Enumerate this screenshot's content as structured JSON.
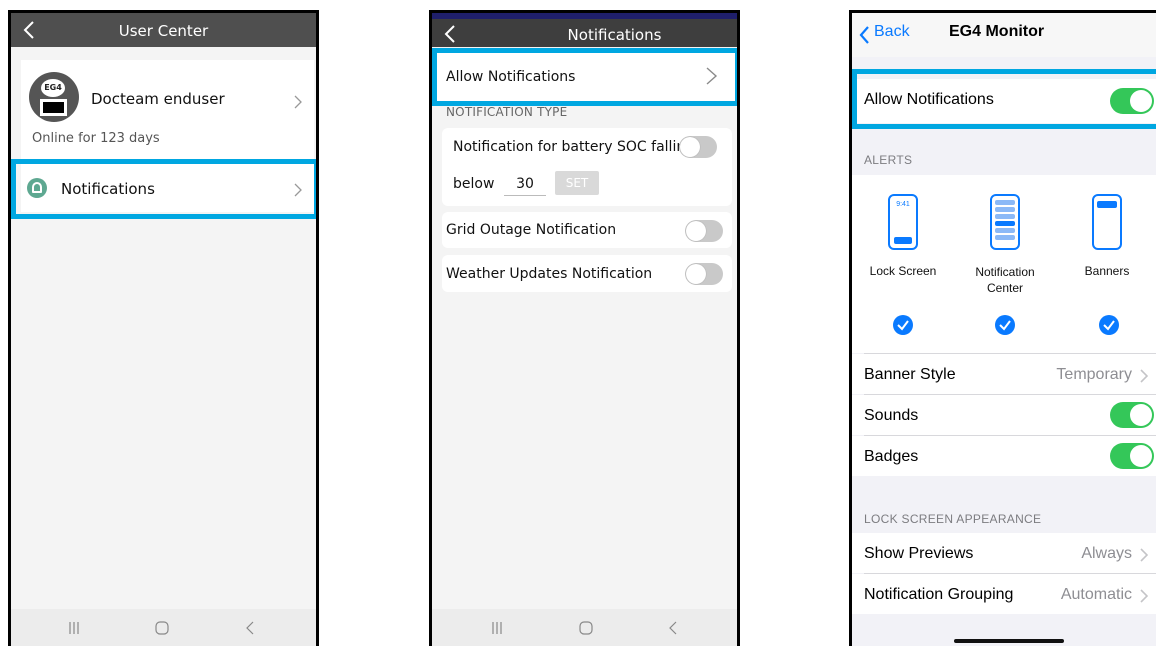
{
  "panel1": {
    "title": "User Center",
    "user_name": "Docteam enduser",
    "online": "Online for 123 days",
    "notifications_label": "Notifications",
    "avatar_text": "EG4"
  },
  "panel2": {
    "title": "Notifications",
    "allow_label": "Allow Notifications",
    "section_label": "NOTIFICATION TYPE",
    "soc_label": "Notification for battery SOC falling",
    "below_label": "below",
    "below_value": "30",
    "set_label": "SET",
    "grid_label": "Grid Outage Notification",
    "weather_label": "Weather Updates Notification"
  },
  "panel3": {
    "back_label": "Back",
    "title": "EG4 Monitor",
    "allow_label": "Allow Notifications",
    "alerts_section": "ALERTS",
    "lock_screen": "Lock Screen",
    "notif_center_1": "Notification",
    "notif_center_2": "Center",
    "banners": "Banners",
    "phone_time": "9:41",
    "banner_style_label": "Banner Style",
    "banner_style_value": "Temporary",
    "sounds_label": "Sounds",
    "badges_label": "Badges",
    "lock_section": "LOCK SCREEN APPEARANCE",
    "previews_label": "Show Previews",
    "previews_value": "Always",
    "grouping_label": "Notification Grouping",
    "grouping_value": "Automatic"
  },
  "colors": {
    "highlight": "#00a7e1",
    "ios_green": "#34c759",
    "ios_blue": "#0a7aff"
  }
}
